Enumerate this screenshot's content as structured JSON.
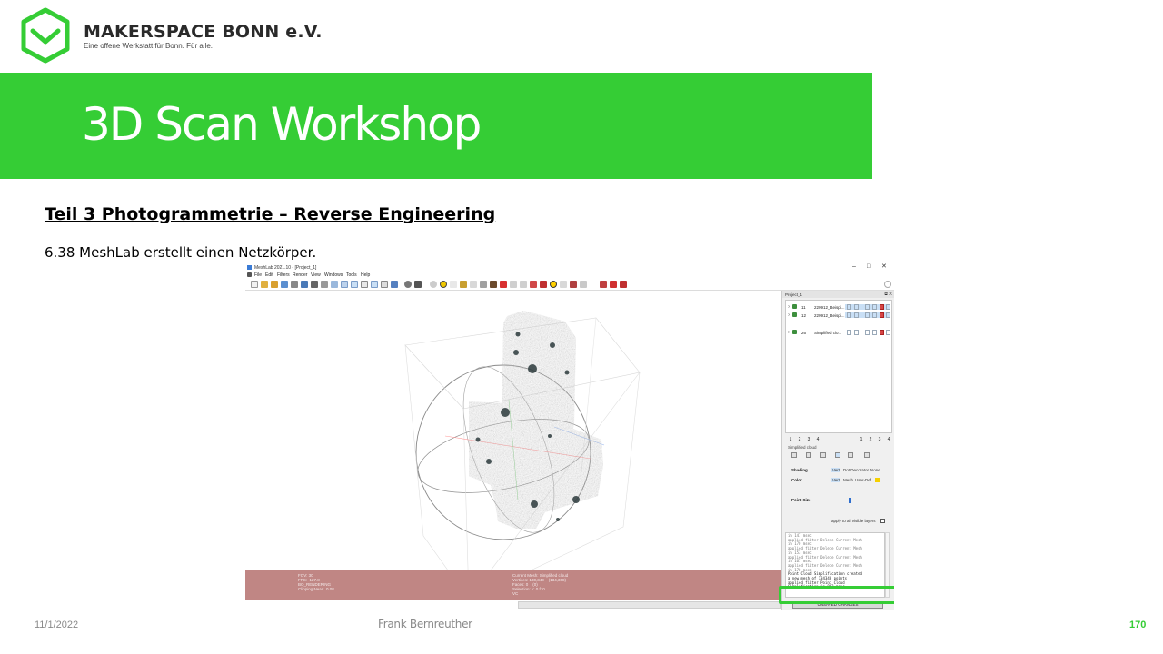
{
  "header": {
    "org_name": "MAKERSPACE BONN e.V.",
    "tagline": "Eine offene Werkstatt für Bonn. Für alle.",
    "title": "3D Scan Workshop",
    "colors": {
      "accent": "#35cd35"
    }
  },
  "content": {
    "section_heading": "Teil 3  Photogrammetrie  – Reverse Engineering",
    "step_text": "6.38 MeshLab erstellt einen Netzkörper."
  },
  "meshlab": {
    "window_title": "MeshLab 2021.10 - [Project_1]",
    "window_controls": {
      "minimize": "–",
      "maximize": "□",
      "close": "✕"
    },
    "menu": [
      "File",
      "Edit",
      "Filters",
      "Render",
      "View",
      "Windows",
      "Tools",
      "Help"
    ],
    "status_left": "FOV: 30\nFPS:  127.8\nBO_RENDERING\nClipping Near:  0.08",
    "status_right": "Current Mesh: Simplified cloud\nVertices: 130,343    (134,368)\nFaces: 0    (0)\nSelection: v: 0 f: 0\nVC",
    "panel": {
      "header_label": "Project_1",
      "header_controls": "⧉ ✕",
      "layers": [
        {
          "arrow": ">",
          "id": "11",
          "name": "220912_Beispi..."
        },
        {
          "arrow": ">",
          "id": "12",
          "name": "220912_Beispi..."
        },
        {
          "arrow": ">",
          "id": "26",
          "name": "Simplified clo..."
        }
      ],
      "page_tabs_left": [
        "1",
        "2",
        "3",
        "4"
      ],
      "page_tabs_right": [
        "1",
        "2",
        "3",
        "4"
      ],
      "sub_label": "Simplified cloud",
      "shading_label": "Shading",
      "shading_options": [
        "Vert",
        "Dot Decorator",
        "None"
      ],
      "color_label": "Color",
      "color_options": [
        "Vert",
        "Mesh",
        "User-Def"
      ],
      "point_size_label": "Point Size",
      "point_size_level": 0.1,
      "apply_label": "apply to all visible layers",
      "log": "in 147 msec\napplied filter Delete Current Mesh\nin 170 msec\napplied filter Delete Current Mesh\nin 153 msec\napplied filter Delete Current Mesh\nin 167 msec\napplied filter Delete Current Mesh\nin 170 msec",
      "log_last": "Point Cloud Simplification created\na new mesh of 134343 points\napplied filter Point Cloud\nSimplification in 893 msec",
      "unsaved_label": "UNSAVED CHANGES"
    }
  },
  "footer": {
    "date": "11/1/2022",
    "author": "Frank Bernreuther",
    "page": "170"
  }
}
